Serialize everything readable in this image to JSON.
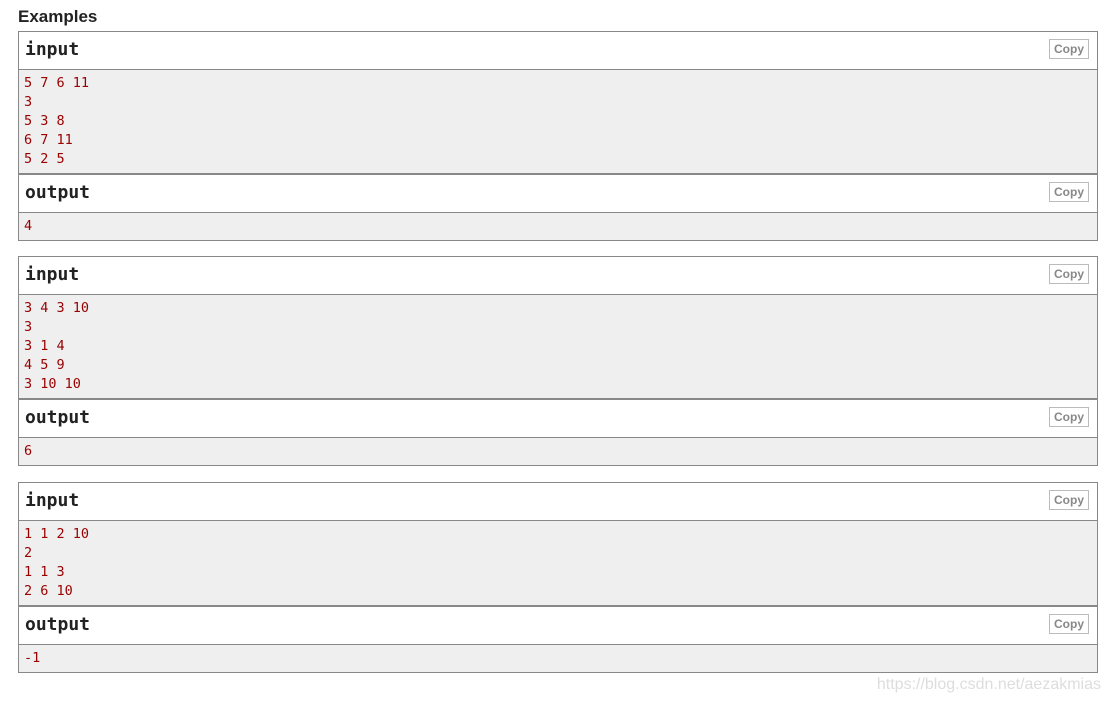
{
  "section_title": "Examples",
  "labels": {
    "input": "input",
    "output": "output",
    "copy": "Copy"
  },
  "examples": [
    {
      "input": "5 7 6 11\n3\n5 3 8\n6 7 11\n5 2 5",
      "output": "4"
    },
    {
      "input": "3 4 3 10\n3\n3 1 4\n4 5 9\n3 10 10",
      "output": "6"
    },
    {
      "input": "1 1 2 10\n2\n1 1 3\n2 6 10",
      "output": "-1"
    }
  ],
  "watermark": "https://blog.csdn.net/aezakmias"
}
